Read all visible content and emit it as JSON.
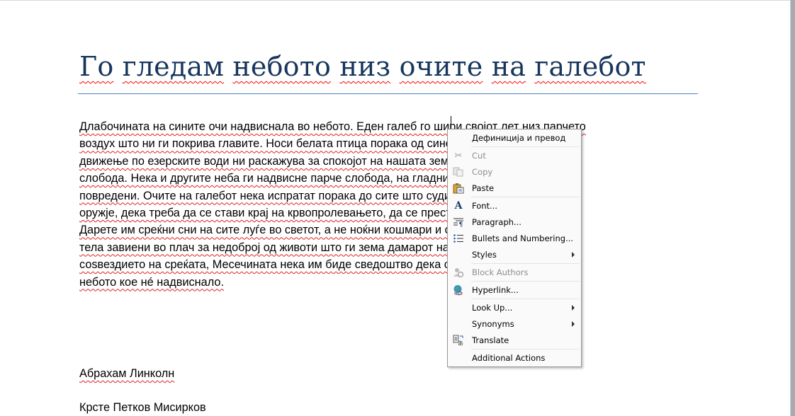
{
  "document": {
    "title_words": [
      "Го",
      "гледам",
      "небото",
      "низ",
      "очите",
      "на",
      "галебот"
    ],
    "paragraph_lines": [
      "Длабочината на сините очи надвиснала во небото. Еден галеб го шири својот лет низ парчето",
      "воздух што ни ги покрива главите. Носи белата птица порака од синевината на нејзиното",
      "движење по езерските води ни раскажува за спокојот на нашата земја, дека живееме во",
      "слобода. Нека и другите неба ги надвисне парче слобода, на гладни, боси, жедни,",
      "повредени. Очите на галебот нека испратат порака до сите што судирите ги решаваат со",
      "оружје, дека треба да се стави крај на крвопролевањето, да се престане со невини жртви.",
      "Дарете им среќни сни на сите луѓе во светот, а не ноќни кошмари и спомени и сеќавања на",
      "тела завиени во плач за недоброј од животи што ги зема дамарот на војната, да живеат под",
      "соѕвездието на среќата, Месечината нека им биде сведоштво дека светот мир го покрил",
      "небото кое нé надвиснало."
    ],
    "signature_1": "Абрахам Линколн",
    "signature_2": "Крсте Петков Мисирков"
  },
  "context_menu": {
    "items": [
      {
        "label": "Дефиниција и превод",
        "icon": "",
        "disabled": false,
        "submenu": false
      },
      {
        "label": "Cut",
        "icon": "scissors-icon",
        "disabled": true,
        "submenu": false
      },
      {
        "label": "Copy",
        "icon": "copy-icon",
        "disabled": true,
        "submenu": false
      },
      {
        "label": "Paste",
        "icon": "paste-icon",
        "disabled": false,
        "submenu": false
      },
      {
        "label": "Font...",
        "icon": "font-icon",
        "disabled": false,
        "submenu": false
      },
      {
        "label": "Paragraph...",
        "icon": "paragraph-icon",
        "disabled": false,
        "submenu": false
      },
      {
        "label": "Bullets and Numbering...",
        "icon": "bullets-icon",
        "disabled": false,
        "submenu": false
      },
      {
        "label": "Styles",
        "icon": "",
        "disabled": false,
        "submenu": true
      },
      {
        "label": "Block Authors",
        "icon": "block-authors-icon",
        "disabled": true,
        "submenu": false
      },
      {
        "label": "Hyperlink...",
        "icon": "hyperlink-icon",
        "disabled": false,
        "submenu": false
      },
      {
        "label": "Look Up...",
        "icon": "",
        "disabled": false,
        "submenu": true
      },
      {
        "label": "Synonyms",
        "icon": "",
        "disabled": false,
        "submenu": true
      },
      {
        "label": "Translate",
        "icon": "translate-icon",
        "disabled": false,
        "submenu": false
      },
      {
        "label": "Additional Actions",
        "icon": "",
        "disabled": false,
        "submenu": false
      }
    ]
  },
  "colors": {
    "heading": "#17365d",
    "heading_rule": "#4f81bd",
    "spelling_underline": "#e02020",
    "disabled_text": "#8d8d8d"
  }
}
